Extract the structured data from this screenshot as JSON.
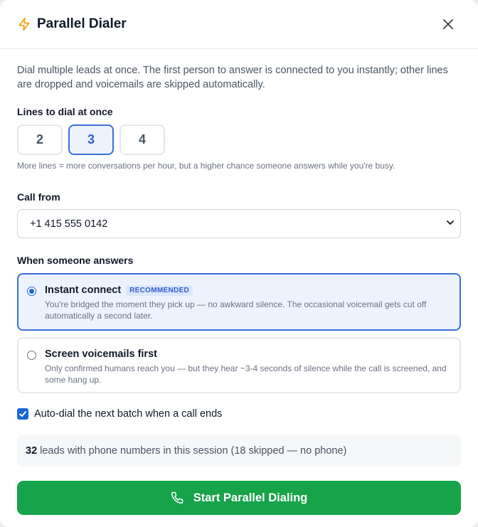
{
  "header": {
    "title": "Parallel Dialer",
    "icon": "lightning-bolt-icon",
    "close_icon": "close-icon"
  },
  "description": "Dial multiple leads at once. The first person to answer is connected to you instantly; other lines are dropped and voicemails are skipped automatically.",
  "lines": {
    "label": "Lines to dial at once",
    "options": [
      "2",
      "3",
      "4"
    ],
    "selected": "3",
    "hint": "More lines = more conversations per hour, but a higher chance someone answers while you're busy."
  },
  "call_from": {
    "label": "Call from",
    "value": "+1 415 555 0142"
  },
  "answer_mode": {
    "label": "When someone answers",
    "options": [
      {
        "title": "Instant connect",
        "badge": "RECOMMENDED",
        "description": "You're bridged the moment they pick up — no awkward silence. The occasional voicemail gets cut off automatically a second later.",
        "selected": true
      },
      {
        "title": "Screen voicemails first",
        "description": "Only confirmed humans reach you — but they hear ~3-4 seconds of silence while the call is screened, and some hang up.",
        "selected": false
      }
    ]
  },
  "auto_dial": {
    "label": "Auto-dial the next batch when a call ends",
    "checked": true
  },
  "session_info": {
    "count": "32",
    "text": "leads with phone numbers in this session (18 skipped — no phone)"
  },
  "start_button": {
    "label": "Start Parallel Dialing",
    "icon": "phone-icon"
  },
  "colors": {
    "accent": "#3b6fd8",
    "accent_bg": "#edf3fd",
    "primary_green": "#16a34a",
    "bolt_orange": "#f59e0b"
  }
}
